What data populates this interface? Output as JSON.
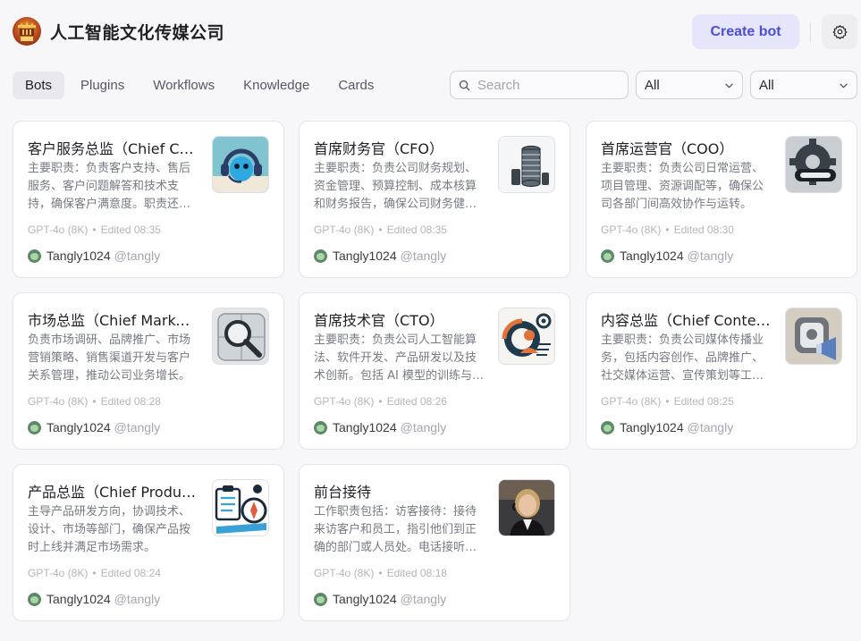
{
  "header": {
    "title": "人工智能文化传媒公司",
    "logo_icon": "company-logo",
    "create_label": "Create bot",
    "settings_icon": "gear-icon"
  },
  "tabs": [
    {
      "label": "Bots",
      "active": true
    },
    {
      "label": "Plugins",
      "active": false
    },
    {
      "label": "Workflows",
      "active": false
    },
    {
      "label": "Knowledge",
      "active": false
    },
    {
      "label": "Cards",
      "active": false
    }
  ],
  "filters": {
    "search_placeholder": "Search",
    "select_1": "All",
    "select_2": "All"
  },
  "cards": [
    {
      "name": "客户服务总监（Chief Customer Service Officer）",
      "desc": "主要职责：负责客户支持、售后服务、客户问题解答和技术支持，确保客户满意度。职责还包括客户关系维护。",
      "model": "GPT-4o (8K)",
      "edited": "Edited 08:35",
      "author": "Tangly1024",
      "handle": "@tangly",
      "icon": "headset-robot-icon"
    },
    {
      "name": "首席财务官（CFO）",
      "desc": "主要职责：负责公司财务规划、资金管理、预算控制、成本核算和财务报告，确保公司财务健康。",
      "model": "GPT-4o (8K)",
      "edited": "Edited 08:35",
      "author": "Tangly1024",
      "handle": "@tangly",
      "icon": "coin-stack-icon"
    },
    {
      "name": "首席运营官（COO）",
      "desc": "主要职责：负责公司日常运营、项目管理、资源调配等，确保公司各部门间高效协作与运转。",
      "model": "GPT-4o (8K)",
      "edited": "Edited 08:30",
      "author": "Tangly1024",
      "handle": "@tangly",
      "icon": "gear-chain-icon"
    },
    {
      "name": "市场总监（Chief Marketing Officer）",
      "desc": "负责市场调研、品牌推广、市场营销策略、销售渠道开发与客户关系管理，推动公司业务增长。",
      "model": "GPT-4o (8K)",
      "edited": "Edited 08:28",
      "author": "Tangly1024",
      "handle": "@tangly",
      "icon": "magnifier-icon"
    },
    {
      "name": "首席技术官（CTO）",
      "desc": "主要职责：负责公司人工智能算法、软件开发、产品研发以及技术创新。包括 AI 模型的训练与优化。",
      "model": "GPT-4o (8K)",
      "edited": "Edited 08:26",
      "author": "Tangly1024",
      "handle": "@tangly",
      "icon": "tech-person-gear-icon"
    },
    {
      "name": "内容总监（Chief Content Officer）",
      "desc": "主要职责：负责公司媒体传播业务，包括内容创作、品牌推广、社交媒体运营、宣传策划等工作。",
      "model": "GPT-4o (8K)",
      "edited": "Edited 08:25",
      "author": "Tangly1024",
      "handle": "@tangly",
      "icon": "megaphone-icon"
    },
    {
      "name": "产品总监（Chief Product Officer）",
      "desc": "主导产品研发方向，协调技术、设计、市场等部门，确保产品按时上线并满足市场需求。",
      "model": "GPT-4o (8K)",
      "edited": "Edited 08:24",
      "author": "Tangly1024",
      "handle": "@tangly",
      "icon": "clipboard-compass-icon"
    },
    {
      "name": "前台接待",
      "desc": "工作职责包括：访客接待：接待来访客户和员工，指引他们到正确的部门或人员处。电话接听与转接。",
      "model": "GPT-4o (8K)",
      "edited": "Edited 08:18",
      "author": "Tangly1024",
      "handle": "@tangly",
      "icon": "receptionist-portrait-icon"
    }
  ]
}
